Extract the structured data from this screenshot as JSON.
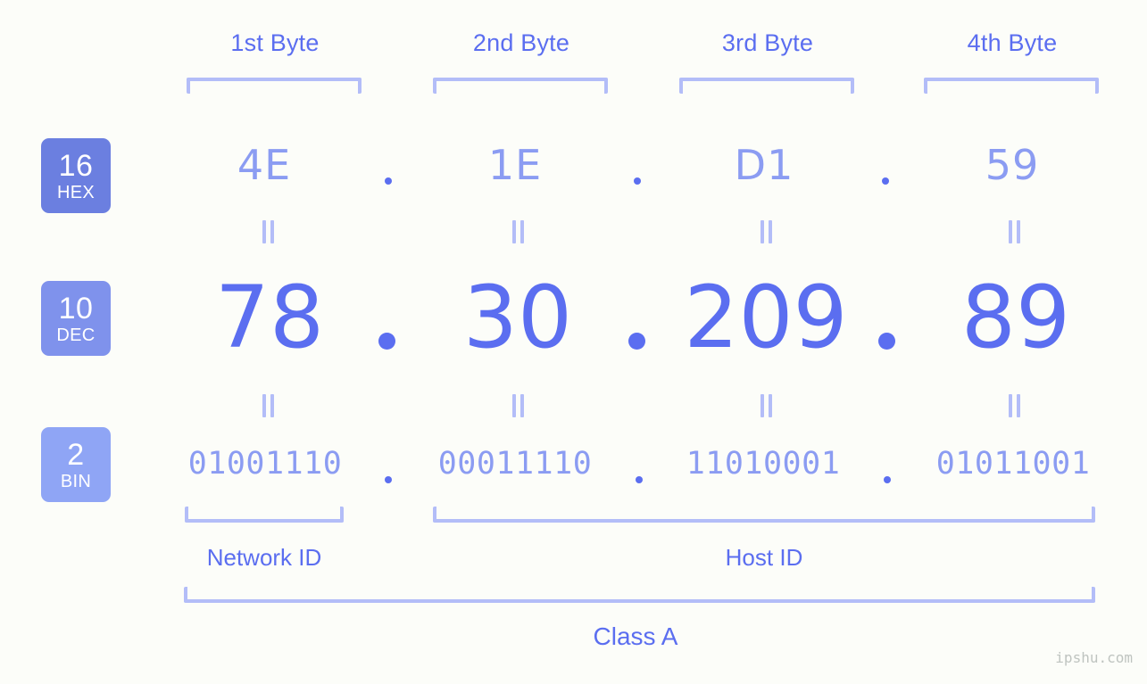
{
  "background_color": "#fcfdf9",
  "accent_color": "#5b6ef0",
  "accent_light_color": "#8b9cf2",
  "bracket_color": "#b3bdf8",
  "byte_headers": [
    {
      "label": "1st Byte"
    },
    {
      "label": "2nd Byte"
    },
    {
      "label": "3rd Byte"
    },
    {
      "label": "4th Byte"
    }
  ],
  "rows": [
    {
      "badge": {
        "base": "16",
        "name": "HEX",
        "color": "#6b7fe0"
      },
      "values": [
        "4E",
        "1E",
        "D1",
        "59"
      ],
      "separator": "."
    },
    {
      "badge": {
        "base": "10",
        "name": "DEC",
        "color": "#7f92ec"
      },
      "values": [
        "78",
        "30",
        "209",
        "89"
      ],
      "separator": "."
    },
    {
      "badge": {
        "base": "2",
        "name": "BIN",
        "color": "#8fa5f5"
      },
      "values": [
        "01001110",
        "00011110",
        "11010001",
        "01011001"
      ],
      "separator": "."
    }
  ],
  "equals_symbol": "=",
  "sections": [
    {
      "label": "Network ID"
    },
    {
      "label": "Host ID"
    }
  ],
  "class_label": "Class A",
  "watermark": "ipshu.com",
  "ip_address": {
    "hex": "4E.1E.D1.59",
    "decimal": "78.30.209.89",
    "binary": "01001110.00011110.11010001.01011001"
  }
}
